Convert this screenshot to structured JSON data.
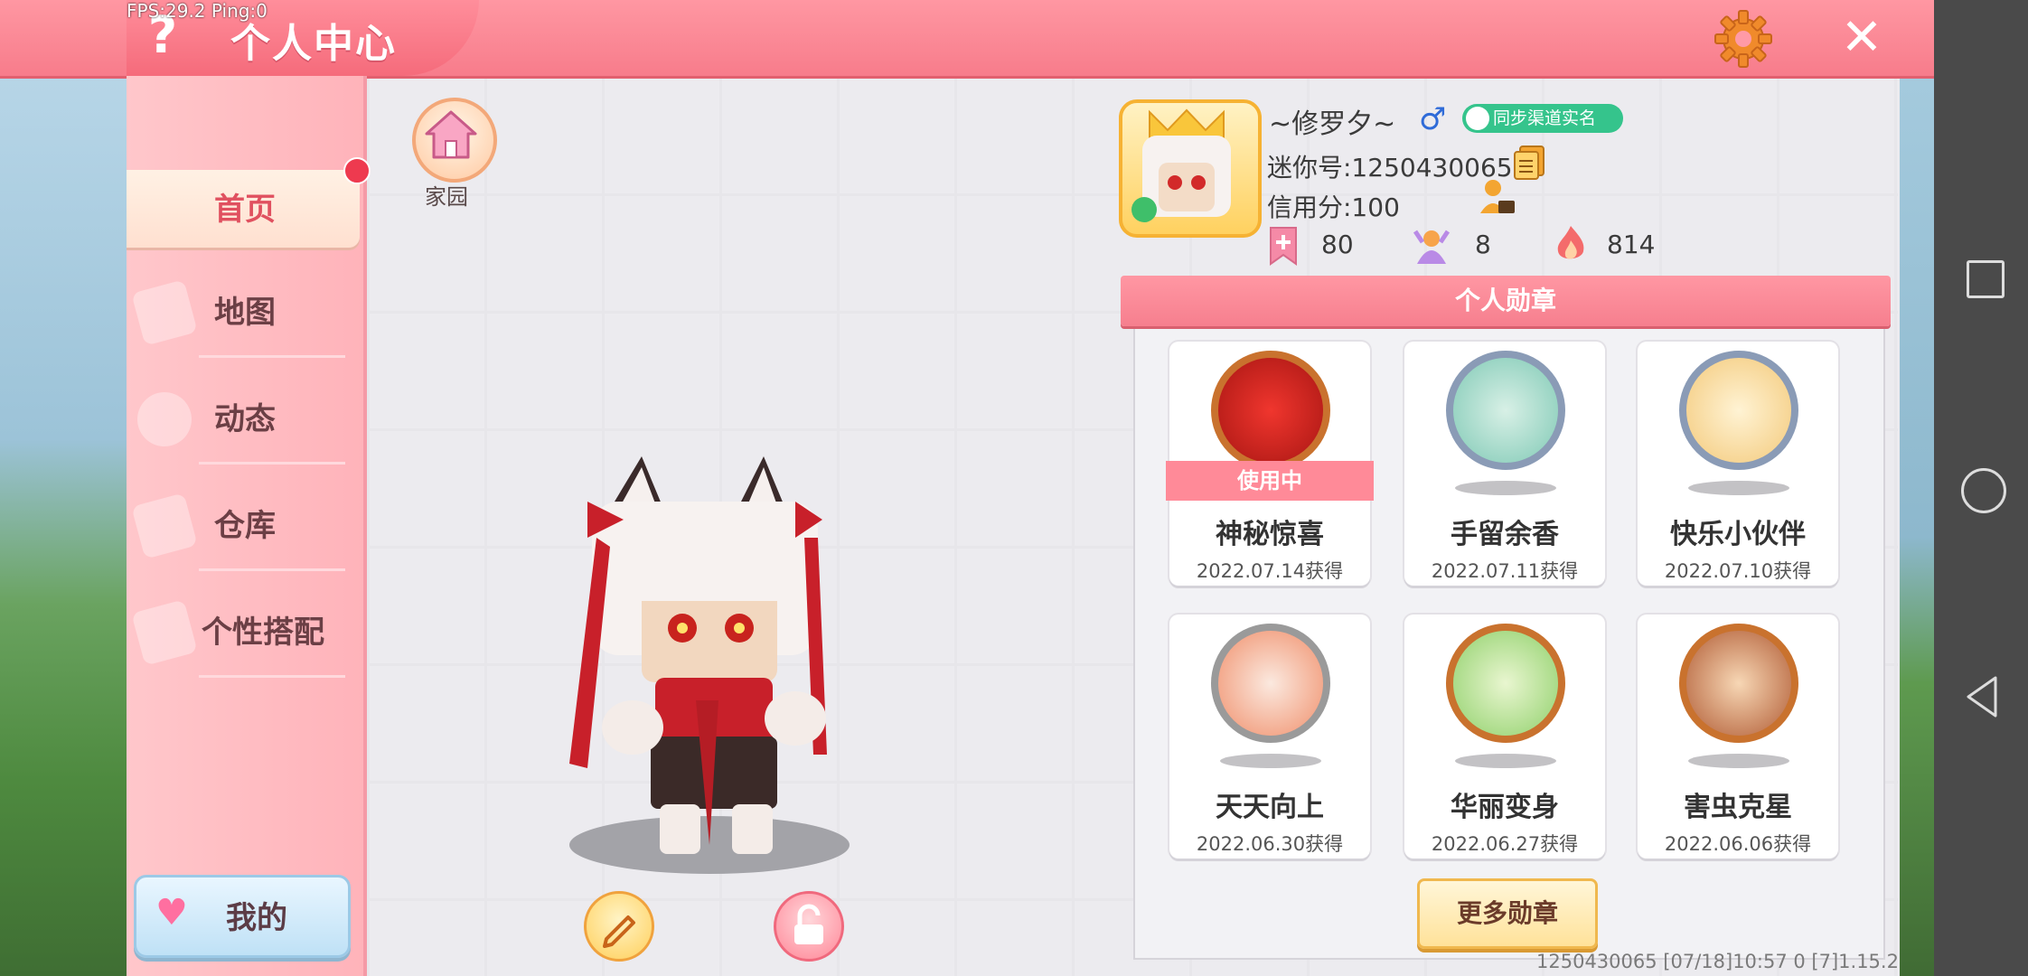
{
  "debug": {
    "fps_text": "FPS:29.2  Ping:0"
  },
  "header": {
    "title": "个人中心"
  },
  "sidebar": {
    "items": [
      {
        "label": "首页"
      },
      {
        "label": "地图"
      },
      {
        "label": "动态"
      },
      {
        "label": "仓库"
      },
      {
        "label": "个性搭配"
      }
    ],
    "my_label": "我的"
  },
  "home": {
    "label": "家园"
  },
  "profile": {
    "nickname": "~修罗夕~",
    "gender_icon": "♂",
    "realname_badge": "同步渠道实名",
    "mini_id": "迷你号:1250430065",
    "credit": "信用分:100",
    "stats": [
      {
        "icon": "bookmark-icon",
        "value": "80"
      },
      {
        "icon": "fans-icon",
        "value": "8"
      },
      {
        "icon": "flame-icon",
        "value": "814"
      }
    ]
  },
  "medals": {
    "title": "个人勋章",
    "in_use_label": "使用中",
    "items": [
      {
        "name": "神秘惊喜",
        "date": "2022.07.14获得",
        "color": "#c9722e"
      },
      {
        "name": "手留余香",
        "date": "2022.07.11获得",
        "color": "#8a9bb6"
      },
      {
        "name": "快乐小伙伴",
        "date": "2022.07.10获得",
        "color": "#8a9bb6"
      },
      {
        "name": "天天向上",
        "date": "2022.06.30获得",
        "color": "#9a9a9a"
      },
      {
        "name": "华丽变身",
        "date": "2022.06.27获得",
        "color": "#c9722e"
      },
      {
        "name": "害虫克星",
        "date": "2022.06.06获得",
        "color": "#c9722e"
      }
    ],
    "more_label": "更多勋章"
  },
  "footer": {
    "info": "1250430065    [07/18]10:57 0    [7]1.15.2"
  },
  "colors": {
    "accent": "#f77c8b",
    "sidebar": "#ffb3ba",
    "badge_green": "#35c48c"
  }
}
